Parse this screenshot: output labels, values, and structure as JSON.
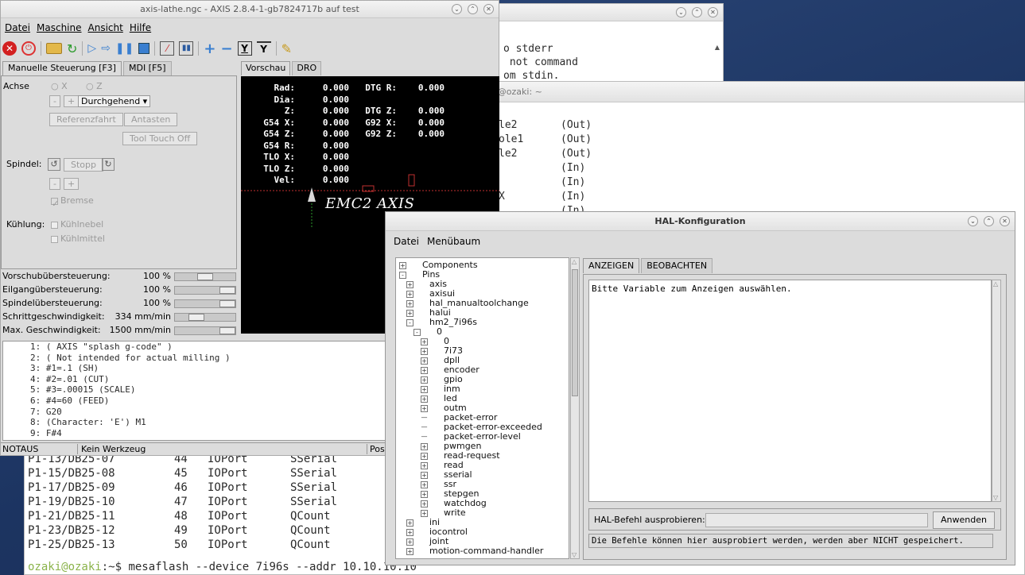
{
  "terminal_back": {
    "lines": [
      "o stderr",
      " not command",
      "om stdin."
    ]
  },
  "terminal_main": {
    "title": "ozaki@ozaki: ~",
    "upper_lines": [
      [
        "le2",
        "(Out)"
      ],
      [
        "ole1",
        "(Out)"
      ],
      [
        "le2",
        "(Out)"
      ],
      [
        "",
        "(In)"
      ],
      [
        "",
        "(In)"
      ],
      [
        "X",
        "(In)"
      ],
      [
        "",
        "(In)"
      ]
    ],
    "lower_rows": [
      [
        "P1-13/DB25-07",
        "44",
        "IOPort",
        "SSerial"
      ],
      [
        "P1-15/DB25-08",
        "45",
        "IOPort",
        "SSerial"
      ],
      [
        "P1-17/DB25-09",
        "46",
        "IOPort",
        "SSerial"
      ],
      [
        "P1-19/DB25-10",
        "47",
        "IOPort",
        "SSerial"
      ],
      [
        "P1-21/DB25-11",
        "48",
        "IOPort",
        "QCount"
      ],
      [
        "P1-23/DB25-12",
        "49",
        "IOPort",
        "QCount"
      ],
      [
        "P1-25/DB25-13",
        "50",
        "IOPort",
        "QCount"
      ]
    ],
    "prompt_user": "ozaki@ozaki",
    "prompt_path": ":~$",
    "prompt_cmd": " mesaflash --device 7i96s --addr 10.10.10.10"
  },
  "axis": {
    "title": "axis-lathe.ngc - AXIS 2.8.4-1-gb7824717b auf test",
    "menu": [
      "Datei",
      "Maschine",
      "Ansicht",
      "Hilfe"
    ],
    "left_tabs": [
      "Manuelle Steuerung [F3]",
      "MDI [F5]"
    ],
    "right_tabs": [
      "Vorschau",
      "DRO"
    ],
    "achse_label": "Achse",
    "axis_x": "X",
    "axis_z": "Z",
    "minus": "-",
    "plus": "+",
    "jog_mode": "Durchgehend",
    "referenzfahrt": "Referenzfahrt",
    "antasten": "Antasten",
    "tool_touch_off": "Tool Touch Off",
    "spindel_label": "Spindel:",
    "stopp": "Stopp",
    "bremse": "Bremse",
    "kuehlung_label": "Kühlung:",
    "kuehlnebel": "Kühlnebel",
    "kuehlmittel": "Kühlmittel",
    "overrides": [
      {
        "label": "Vorschubübersteuerung:",
        "value": "100 %",
        "level": 0.5
      },
      {
        "label": "Eilgangübersteuerung:",
        "value": "100 %",
        "level": 1.0
      },
      {
        "label": "Spindelübersteuerung:",
        "value": "100 %",
        "level": 1.0
      },
      {
        "label": "Schrittgeschwindigkeit:",
        "value": "334 mm/min",
        "level": 0.3
      },
      {
        "label": "Max. Geschwindigkeit:",
        "value": "1500 mm/min",
        "level": 1.0
      }
    ],
    "dro": [
      [
        "Rad:",
        "0.000",
        "DTG R:",
        "0.000"
      ],
      [
        "Dia:",
        "0.000",
        "",
        ""
      ],
      [
        "Z:",
        "0.000",
        "DTG Z:",
        "0.000"
      ],
      [
        "G54 X:",
        "0.000",
        "G92 X:",
        "0.000"
      ],
      [
        "G54 Z:",
        "0.000",
        "G92 Z:",
        "0.000"
      ],
      [
        "G54 R:",
        "0.000",
        "",
        ""
      ],
      [
        "TLO X:",
        "0.000",
        "",
        ""
      ],
      [
        "TLO Z:",
        "0.000",
        "",
        ""
      ],
      [
        "Vel:",
        "0.000",
        "",
        ""
      ]
    ],
    "preview_logo": "EMC2 AXIS",
    "gcode": [
      "1: ( AXIS \"splash g-code\" )",
      "2: ( Not intended for actual milling )",
      "3: #1=.1 (SH)",
      "4: #2=.01 (CUT)",
      "5: #3=.00015 (SCALE)",
      "6: #4=60 (FEED)",
      "7: G20",
      "8: (Character: 'E') M1",
      "9: F#4"
    ],
    "status_state": "NOTAUS",
    "status_tool": "Kein Werkzeug",
    "status_pos": "Pos"
  },
  "hal": {
    "title": "HAL-Konfiguration",
    "menu": [
      "Datei",
      "Menübaum"
    ],
    "tabs": [
      "ANZEIGEN",
      "BEOBACHTEN"
    ],
    "tree": [
      {
        "label": "Components",
        "depth": 0,
        "exp": "+"
      },
      {
        "label": "Pins",
        "depth": 0,
        "exp": "-"
      },
      {
        "label": "axis",
        "depth": 1,
        "exp": "+"
      },
      {
        "label": "axisui",
        "depth": 1,
        "exp": "+"
      },
      {
        "label": "hal_manualtoolchange",
        "depth": 1,
        "exp": "+"
      },
      {
        "label": "halui",
        "depth": 1,
        "exp": "+"
      },
      {
        "label": "hm2_7i96s",
        "depth": 1,
        "exp": "-"
      },
      {
        "label": "0",
        "depth": 2,
        "exp": "-"
      },
      {
        "label": "0",
        "depth": 3,
        "exp": "+"
      },
      {
        "label": "7i73",
        "depth": 3,
        "exp": "+"
      },
      {
        "label": "dpll",
        "depth": 3,
        "exp": "+"
      },
      {
        "label": "encoder",
        "depth": 3,
        "exp": "+"
      },
      {
        "label": "gpio",
        "depth": 3,
        "exp": "+"
      },
      {
        "label": "inm",
        "depth": 3,
        "exp": "+"
      },
      {
        "label": "led",
        "depth": 3,
        "exp": "+"
      },
      {
        "label": "outm",
        "depth": 3,
        "exp": "+"
      },
      {
        "label": "packet-error",
        "depth": 3,
        "exp": ""
      },
      {
        "label": "packet-error-exceeded",
        "depth": 3,
        "exp": ""
      },
      {
        "label": "packet-error-level",
        "depth": 3,
        "exp": ""
      },
      {
        "label": "pwmgen",
        "depth": 3,
        "exp": "+"
      },
      {
        "label": "read-request",
        "depth": 3,
        "exp": "+"
      },
      {
        "label": "read",
        "depth": 3,
        "exp": "+"
      },
      {
        "label": "sserial",
        "depth": 3,
        "exp": "+"
      },
      {
        "label": "ssr",
        "depth": 3,
        "exp": "+"
      },
      {
        "label": "stepgen",
        "depth": 3,
        "exp": "+"
      },
      {
        "label": "watchdog",
        "depth": 3,
        "exp": "+"
      },
      {
        "label": "write",
        "depth": 3,
        "exp": "+"
      },
      {
        "label": "ini",
        "depth": 1,
        "exp": "+"
      },
      {
        "label": "iocontrol",
        "depth": 1,
        "exp": "+"
      },
      {
        "label": "joint",
        "depth": 1,
        "exp": "+"
      },
      {
        "label": "motion-command-handler",
        "depth": 1,
        "exp": "+"
      }
    ],
    "show_text": "Bitte Variable zum Anzeigen auswählen.",
    "cmd_label": "HAL-Befehl ausprobieren:",
    "cmd_value": "",
    "apply_button": "Anwenden",
    "footer_text": "Die Befehle können hier ausprobiert werden, werden aber NICHT gespeichert."
  }
}
